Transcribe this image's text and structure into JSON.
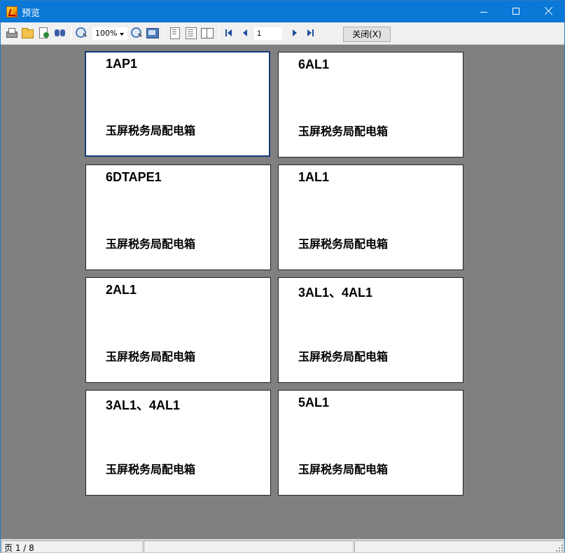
{
  "window": {
    "title": "预览",
    "minimize_icon": "minimize-icon",
    "maximize_icon": "maximize-icon",
    "close_icon": "close-icon"
  },
  "toolbar": {
    "icons": [
      "print-icon",
      "open-icon",
      "export-icon",
      "find-icon",
      "zoom-in-icon",
      "zoom-out-icon",
      "fit-page-icon",
      "single-page-icon",
      "multi-page-icon",
      "book-view-icon",
      "first-page-icon",
      "previous-page-icon",
      "next-page-icon",
      "last-page-icon"
    ],
    "zoom_value": "100%",
    "page_value": "1",
    "close_label": "关闭(X)"
  },
  "pages": [
    {
      "code": "1AP1",
      "name": "玉屏税务局配电箱"
    },
    {
      "code": "6AL1",
      "name": "玉屏税务局配电箱"
    },
    {
      "code": "6DTAPE1",
      "name": "玉屏税务局配电箱"
    },
    {
      "code": "1AL1",
      "name": "玉屏税务局配电箱"
    },
    {
      "code": "2AL1",
      "name": "玉屏税务局配电箱"
    },
    {
      "code": "3AL1、4AL1",
      "name": "玉屏税务局配电箱"
    },
    {
      "code": "3AL1、4AL1",
      "name": "玉屏税务局配电箱"
    },
    {
      "code": "5AL1",
      "name": "玉屏税务局配电箱"
    }
  ],
  "status": {
    "page_info": "页 1 / 8"
  },
  "colors": {
    "titlebar": "#0a78d7",
    "preview_background": "#808080",
    "selected_border": "#123a76"
  }
}
